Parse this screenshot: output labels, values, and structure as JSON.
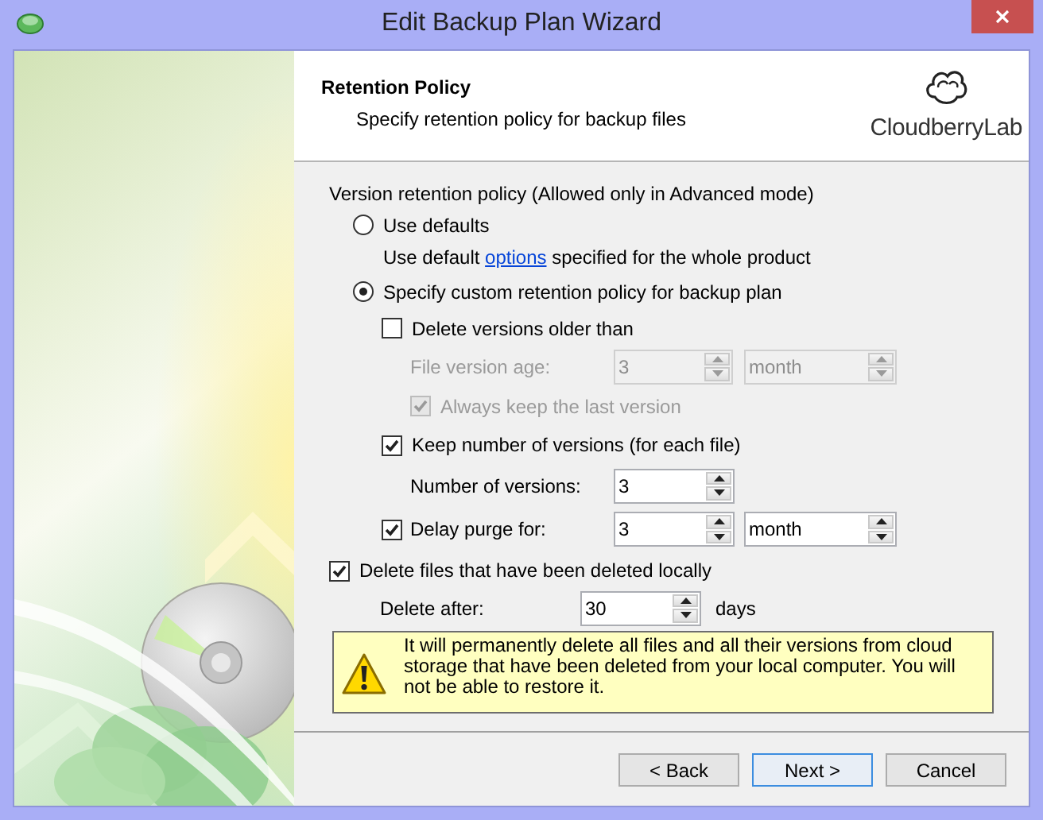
{
  "window": {
    "title": "Edit Backup Plan Wizard"
  },
  "header": {
    "title": "Retention Policy",
    "subtitle": "Specify retention policy for backup files",
    "logo": "CloudberryLab"
  },
  "section_label": "Version retention policy (Allowed only in Advanced mode)",
  "radios": [
    {
      "label": "Use defaults",
      "selected": false,
      "note": {
        "before": "Use default",
        "link": "options",
        "after": "specified for the whole product"
      }
    },
    {
      "label": "Specify custom retention policy for backup plan",
      "selected": true
    }
  ],
  "custom": {
    "delete_older": {
      "label": "Delete versions older than",
      "checked": false
    },
    "age": {
      "label": "File version age:",
      "value": "3",
      "unit": "month",
      "disabled": true
    },
    "keep_last": {
      "label": "Always keep the last version",
      "checked": true,
      "disabled": true
    },
    "keep_number": {
      "label": "Keep number of versions (for each file)",
      "checked": true
    },
    "number": {
      "label": "Number of versions:",
      "value": "3"
    },
    "delay": {
      "label": "Delay purge for:",
      "checked": true,
      "value": "3",
      "unit": "month"
    }
  },
  "delete_local": {
    "label": "Delete files that have been deleted locally",
    "checked": true
  },
  "delete_after": {
    "label": "Delete after:",
    "value": "30",
    "unit": "days"
  },
  "warning": "It will permanently delete all files and all their versions from cloud storage that have been deleted from your local computer. You will not be able to restore it.",
  "buttons": [
    {
      "label": "< Back",
      "default": false
    },
    {
      "label": "Next >",
      "default": true
    },
    {
      "label": "Cancel",
      "default": false
    }
  ]
}
